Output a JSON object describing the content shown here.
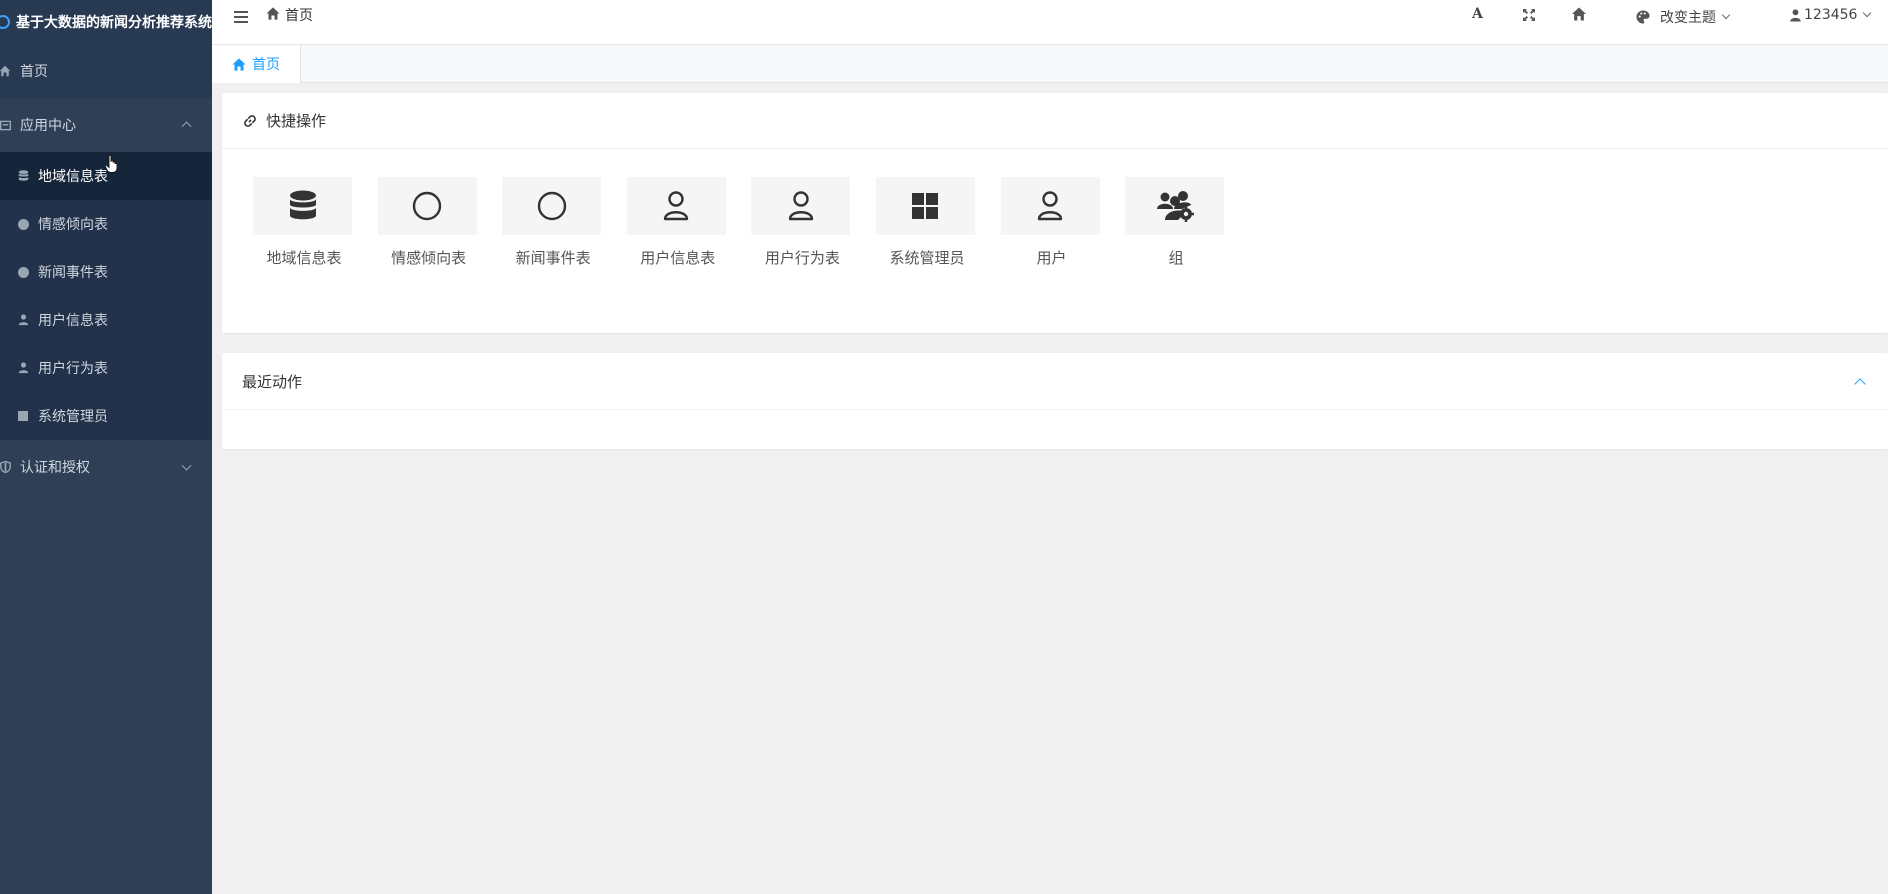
{
  "app": {
    "title": "基于大数据的新闻分析推荐系统"
  },
  "sidebar": {
    "home": "首页",
    "app_center": "应用中心",
    "app_center_items": [
      {
        "label": "地域信息表",
        "icon": "database-icon"
      },
      {
        "label": "情感倾向表",
        "icon": "circle-icon"
      },
      {
        "label": "新闻事件表",
        "icon": "circle-icon"
      },
      {
        "label": "用户信息表",
        "icon": "user-icon"
      },
      {
        "label": "用户行为表",
        "icon": "user-icon"
      },
      {
        "label": "系统管理员",
        "icon": "square-icon"
      }
    ],
    "auth": "认证和授权"
  },
  "header": {
    "breadcrumb_home": "首页",
    "theme": "改变主题",
    "user": "123456",
    "font_button": "A"
  },
  "tabs": [
    {
      "label": "首页",
      "active": true
    }
  ],
  "quick_actions": {
    "title": "快捷操作",
    "items": [
      {
        "label": "地域信息表",
        "icon": "database-icon"
      },
      {
        "label": "情感倾向表",
        "icon": "circle-icon"
      },
      {
        "label": "新闻事件表",
        "icon": "circle-icon"
      },
      {
        "label": "用户信息表",
        "icon": "user-icon"
      },
      {
        "label": "用户行为表",
        "icon": "user-icon"
      },
      {
        "label": "系统管理员",
        "icon": "windows-icon"
      },
      {
        "label": "用户",
        "icon": "user-icon"
      },
      {
        "label": "组",
        "icon": "users-gear-icon"
      }
    ]
  },
  "recent_actions": {
    "title": "最近动作"
  },
  "colors": {
    "sidebar_bg": "#2f4056",
    "sidebar_active": "#16263a",
    "accent": "#1e9fff"
  }
}
